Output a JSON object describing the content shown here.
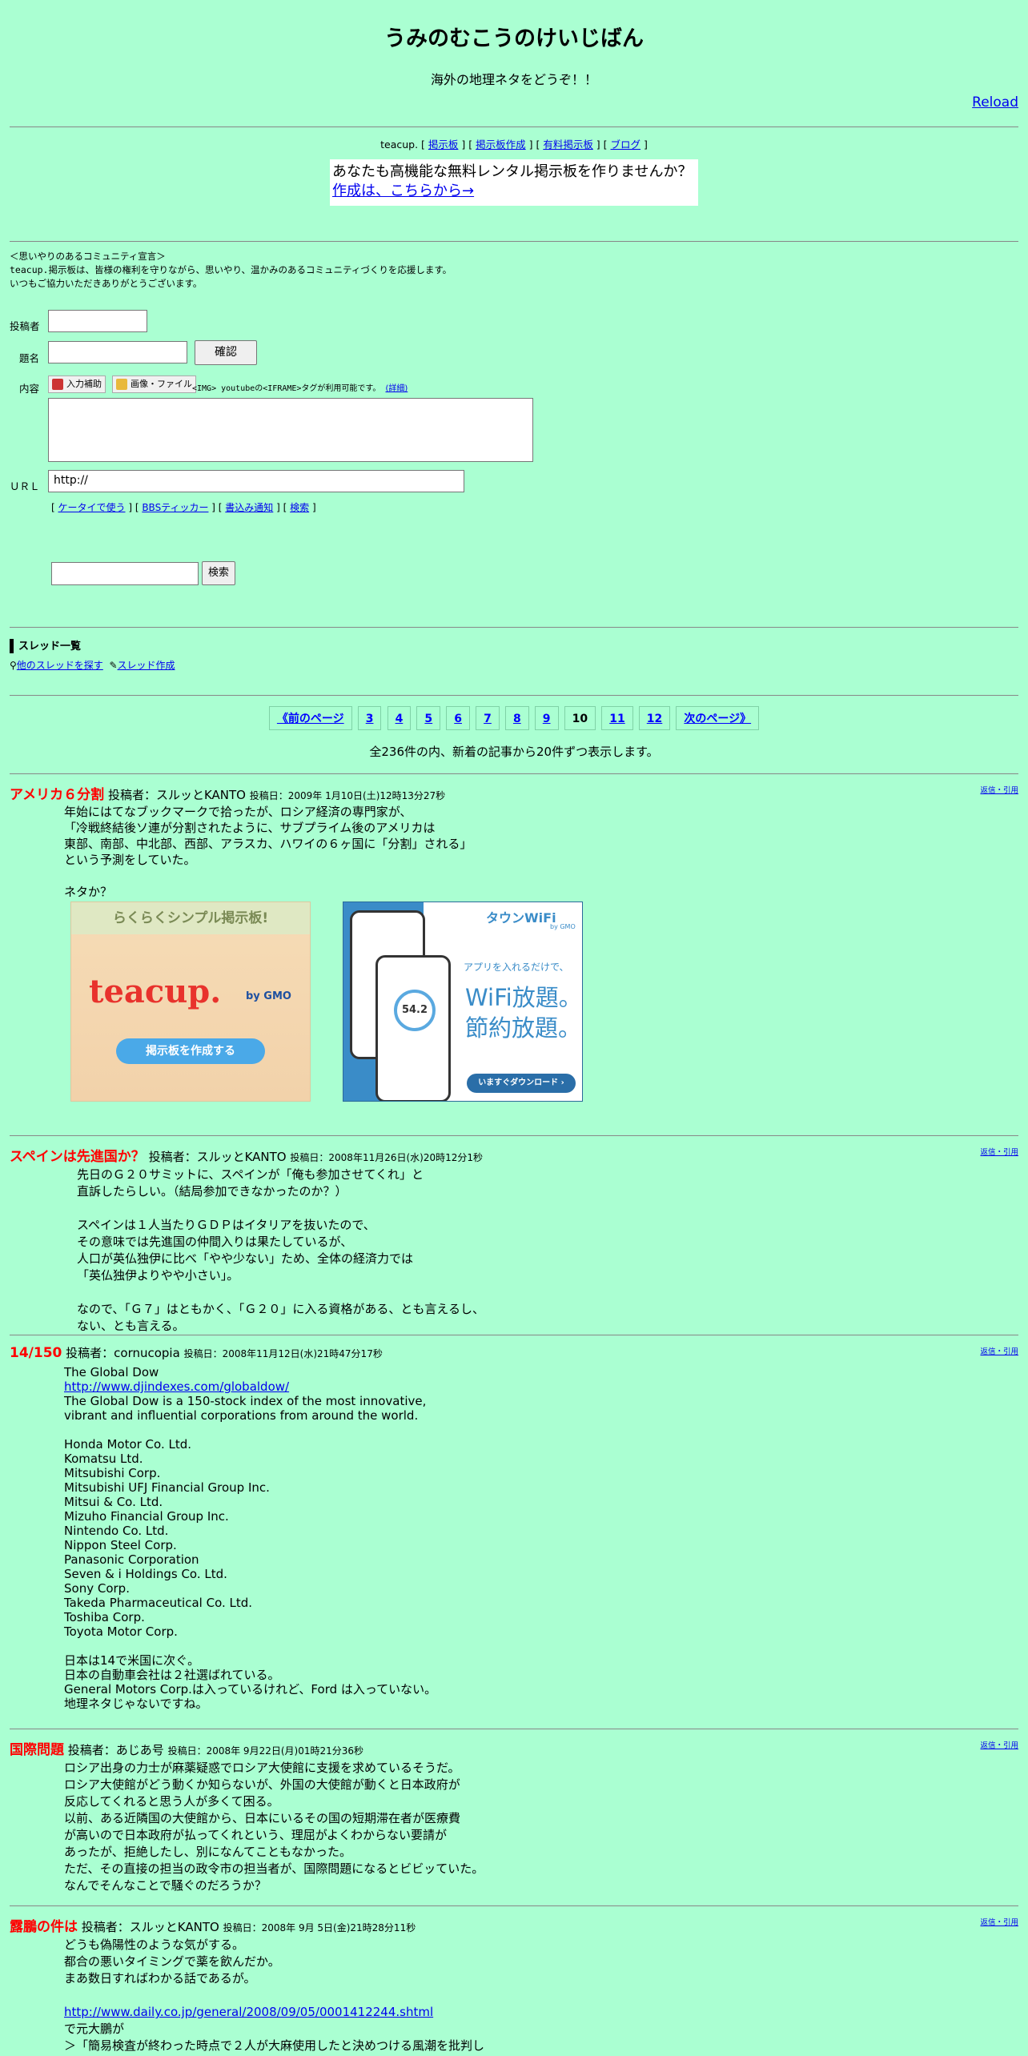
{
  "header": {
    "title": "うみのむこうのけいじばん",
    "subtitle": "海外の地理ネタをどうぞ！！",
    "reload": "Reload"
  },
  "teacup_bar": {
    "brand": "teacup.",
    "links": [
      "掲示板",
      "掲示板作成",
      "有料掲示板",
      "ブログ"
    ]
  },
  "ad": {
    "text": "あなたも高機能な無料レンタル掲示板を作りませんか？",
    "link": "作成は、こちらから→"
  },
  "declaration": {
    "heading": "＜思いやりのあるコミュニティ宣言＞",
    "brand": "teacup.",
    "line1": "掲示板は、皆様の権利を守りながら、思いやり、温かみのあるコミュニティづくりを応援します。",
    "line2": "いつもご協力いただきありがとうございます。"
  },
  "form": {
    "author_label": "投稿者",
    "subject_label": "題名",
    "content_label": "内容",
    "url_label": "ＵＲＬ",
    "confirm_button": "確認",
    "input_assist": "入力補助",
    "image_file": "画像・ファイル",
    "tags_note": "<IMG> youtubeの<IFRAME>タグが利用可能です。",
    "details_link": "(詳細)",
    "url_value": "http://",
    "links": [
      "ケータイで使う",
      "BBSティッカー",
      "書込み通知",
      "検索"
    ],
    "search_button": "検索"
  },
  "threads": {
    "heading": "スレッド一覧",
    "find_link": "他のスレッドを探す",
    "create_link": "スレッド作成"
  },
  "pager": {
    "prev": "《前のページ",
    "pages": [
      "3",
      "4",
      "5",
      "6",
      "7",
      "8",
      "9",
      "10",
      "11",
      "12"
    ],
    "current": "10",
    "next": "次のページ》",
    "info": "全236件の内、新着の記事から20件ずつ表示します。"
  },
  "banners": {
    "teacup_top": "らくらくシンプル掲示板!",
    "teacup_logo": "teacup.",
    "teacup_by": "by GMO",
    "teacup_button": "掲示板を作成する",
    "wifi_brand": "タウンWiFi",
    "wifi_by": "by GMO",
    "wifi_line1": "アプリを入れるだけで、",
    "wifi_line2": "WiFi放題。",
    "wifi_line3": "節約放題。",
    "wifi_button": "いますぐダウンロード ›",
    "wifi_speed": "54.2"
  },
  "posts": [
    {
      "title": "アメリカ６分割",
      "author": "投稿者：スルッとKANTO",
      "date": "投稿日：2009年 1月10日(土)12時13分27秒",
      "reply": "返信・引用",
      "body": "年始にはてなブックマークで拾ったが、ロシア経済の専門家が、\n「冷戦終結後ソ連が分割されたように、サブプライム後のアメリカは\n東部、南部、中北部、西部、アラスカ、ハワイの６ヶ国に「分割」される」\nという予測をしていた。\n\nネタか？"
    },
    {
      "title": "スペインは先進国か？",
      "author": "投稿者：スルッとKANTO",
      "date": "投稿日：2008年11月26日(水)20時12分1秒",
      "reply": "返信・引用",
      "body": "先日のＧ２０サミットに、スペインが「俺も参加させてくれ」と\n直訴したらしい。（結局参加できなかったのか？）\n\nスペインは１人当たりＧＤＰはイタリアを抜いたので、\nその意味では先進国の仲間入りは果たしているが、\n人口が英仏独伊に比べ「やや少ない」ため、全体の経済力では\n「英仏独伊よりやや小さい」。\n\nなので、「Ｇ７」はともかく、「Ｇ２０」に入る資格がある、とも言えるし、\nない、とも言える。"
    },
    {
      "title": "14/150",
      "author": "投稿者：cornucopia",
      "date": "投稿日：2008年11月12日(水)21時47分17秒",
      "reply": "返信・引用",
      "body1": "The Global Dow",
      "link": "http://www.djindexes.com/globaldow/",
      "body2": "The Global Dow is a 150-stock index of the most innovative,\nvibrant and influential corporations from around the world.\n\nHonda Motor Co. Ltd.\nKomatsu Ltd.\nMitsubishi Corp.\nMitsubishi UFJ Financial Group Inc.\nMitsui & Co. Ltd.\nMizuho Financial Group Inc.\nNintendo Co. Ltd.\nNippon Steel Corp.\nPanasonic Corporation\nSeven & i Holdings Co. Ltd.\nSony Corp.\nTakeda Pharmaceutical Co. Ltd.\nToshiba Corp.\nToyota Motor Corp.\n\n日本は14で米国に次ぐ。\n日本の自動車会社は２社選ばれている。\nGeneral Motors Corp.は入っているけれど、Ford は入っていない。\n地理ネタじゃないですね。"
    },
    {
      "title": "国際問題",
      "author": "投稿者：あじあ号",
      "date": "投稿日：2008年 9月22日(月)01時21分36秒",
      "reply": "返信・引用",
      "body": "ロシア出身の力士が麻薬疑惑でロシア大使館に支援を求めているそうだ。\nロシア大使館がどう動くか知らないが、外国の大使館が動くと日本政府が\n反応してくれると思う人が多くて困る。\n以前、ある近隣国の大使館から、日本にいるその国の短期滞在者が医療費\nが高いので日本政府が払ってくれという、理屈がよくわからない要請が\nあったが、拒絶したし、別になんてこともなかった。\nただ、その直接の担当の政令市の担当者が、国際問題になるとビビッていた。\nなんでそんなことで騒ぐのだろうか？"
    },
    {
      "title": "露鵬の件は",
      "author": "投稿者：スルッとKANTO",
      "date": "投稿日：2008年 9月 5日(金)21時28分11秒",
      "reply": "返信・引用",
      "body1": "どうも偽陽性のような気がする。\n都合の悪いタイミングで薬を飲んだか。\nまあ数日すればわかる話であるが。",
      "link": "http://www.daily.co.jp/general/2008/09/05/0001412244.shtml",
      "body2": "で元大鵬が\n＞「簡易検査が終わった時点で２人が大麻使用したと決めつける風潮を批判し"
    }
  ]
}
